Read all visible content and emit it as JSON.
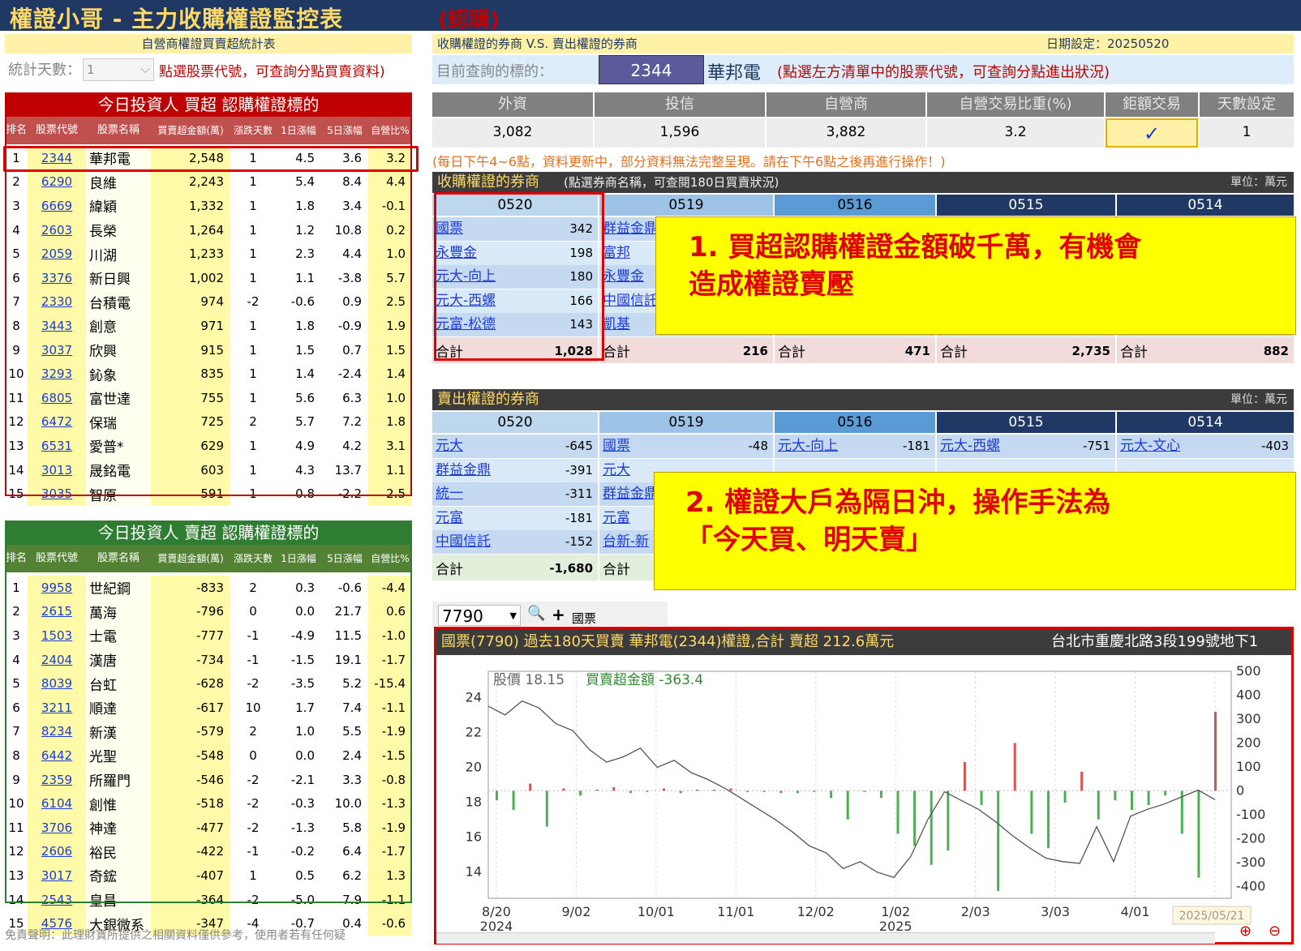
{
  "app": {
    "title": "權證小哥 - 主力收購權證監控表",
    "subtitle": "(認購)"
  },
  "left": {
    "top_bar": "自營商權證買賣超統計表",
    "days_label": "統計天數：",
    "days_value": "1",
    "hint": "點選股票代號，可查詢分點買賣資料)",
    "buy_title": "今日投資人 買超 認購權證標的",
    "sell_title": "今日投資人 賣超 認購權證標的",
    "headers": [
      "排名",
      "股票代號",
      "股票名稱",
      "買賣超金額(萬)",
      "漲跌天數",
      "1日漲幅",
      "5日漲幅",
      "自營比%"
    ],
    "buy_rows": [
      [
        "1",
        "2344",
        "華邦電",
        "2,548",
        "1",
        "4.5",
        "3.6",
        "3.2"
      ],
      [
        "2",
        "6290",
        "良維",
        "2,243",
        "1",
        "5.4",
        "8.4",
        "4.4"
      ],
      [
        "3",
        "6669",
        "緯穎",
        "1,332",
        "1",
        "1.8",
        "3.4",
        "-0.1"
      ],
      [
        "4",
        "2603",
        "長榮",
        "1,264",
        "1",
        "1.2",
        "10.8",
        "0.2"
      ],
      [
        "5",
        "2059",
        "川湖",
        "1,233",
        "1",
        "2.3",
        "4.4",
        "1.0"
      ],
      [
        "6",
        "3376",
        "新日興",
        "1,002",
        "1",
        "1.1",
        "-3.8",
        "5.7"
      ],
      [
        "7",
        "2330",
        "台積電",
        "974",
        "-2",
        "-0.6",
        "0.9",
        "2.5"
      ],
      [
        "8",
        "3443",
        "創意",
        "971",
        "1",
        "1.8",
        "-0.9",
        "1.9"
      ],
      [
        "9",
        "3037",
        "欣興",
        "915",
        "1",
        "1.5",
        "0.7",
        "1.5"
      ],
      [
        "10",
        "3293",
        "鈊象",
        "835",
        "1",
        "1.4",
        "-2.4",
        "1.4"
      ],
      [
        "11",
        "6805",
        "富世達",
        "755",
        "1",
        "5.6",
        "6.3",
        "1.0"
      ],
      [
        "12",
        "6472",
        "保瑞",
        "725",
        "2",
        "5.7",
        "7.2",
        "1.8"
      ],
      [
        "13",
        "6531",
        "愛普*",
        "629",
        "1",
        "4.9",
        "4.2",
        "3.1"
      ],
      [
        "14",
        "3013",
        "晟銘電",
        "603",
        "1",
        "4.3",
        "13.7",
        "1.1"
      ],
      [
        "15",
        "3035",
        "智原",
        "591",
        "1",
        "0.8",
        "-2.2",
        "2.5"
      ]
    ],
    "sell_rows": [
      [
        "1",
        "9958",
        "世紀鋼",
        "-833",
        "2",
        "0.3",
        "-0.6",
        "-4.4"
      ],
      [
        "2",
        "2615",
        "萬海",
        "-796",
        "0",
        "0.0",
        "21.7",
        "0.6"
      ],
      [
        "3",
        "1503",
        "士電",
        "-777",
        "-1",
        "-4.9",
        "11.5",
        "-1.0"
      ],
      [
        "4",
        "2404",
        "漢唐",
        "-734",
        "-1",
        "-1.5",
        "19.1",
        "-1.7"
      ],
      [
        "5",
        "8039",
        "台虹",
        "-628",
        "-2",
        "-3.5",
        "5.2",
        "-15.4"
      ],
      [
        "6",
        "3211",
        "順達",
        "-617",
        "10",
        "1.7",
        "7.4",
        "-1.1"
      ],
      [
        "7",
        "8234",
        "新漢",
        "-579",
        "2",
        "1.0",
        "5.5",
        "-1.9"
      ],
      [
        "8",
        "6442",
        "光聖",
        "-548",
        "0",
        "0.0",
        "2.4",
        "-1.5"
      ],
      [
        "9",
        "2359",
        "所羅門",
        "-546",
        "-2",
        "-2.1",
        "3.3",
        "-0.8"
      ],
      [
        "10",
        "6104",
        "創惟",
        "-518",
        "-2",
        "-0.3",
        "10.0",
        "-1.3"
      ],
      [
        "11",
        "3706",
        "神達",
        "-477",
        "-2",
        "-1.3",
        "5.8",
        "-1.9"
      ],
      [
        "12",
        "2606",
        "裕民",
        "-422",
        "-1",
        "-0.2",
        "6.4",
        "-1.7"
      ],
      [
        "13",
        "3017",
        "奇鋐",
        "-407",
        "1",
        "0.5",
        "6.2",
        "1.3"
      ],
      [
        "14",
        "2543",
        "皇昌",
        "-364",
        "-2",
        "-5.0",
        "7.9",
        "-1.1"
      ],
      [
        "15",
        "4576",
        "大銀微系",
        "-347",
        "-4",
        "-0.7",
        "0.4",
        "-0.6"
      ]
    ],
    "disclaimer": "免責聲明：此理財寶所提供之相關資料僅供參考，使用者若有任何疑"
  },
  "right": {
    "bar_title": "收購權證的券商 V.S. 賣出權證的券商",
    "date_label": "日期設定：",
    "date_value": "20250520",
    "query_label": "目前查詢的標的：",
    "query_code": "2344",
    "query_name": "華邦電",
    "query_hint": "(點選左方清單中的股票代號，可查詢分點進出狀況)",
    "stats_headers": [
      "外資",
      "投信",
      "自營商",
      "自營交易比重(%)",
      "鉅額交易",
      "天數設定"
    ],
    "stats_values": [
      "3,082",
      "1,596",
      "3,882",
      "3.2",
      "✓",
      "1"
    ],
    "notice": "(每日下午4~6點，資料更新中，部分資料無法完整呈現。請在下午6點之後再進行操作！)",
    "buy_section": {
      "title": "收購權證的券商",
      "hint": "(點選券商名稱，可查閱180日買賣狀況)",
      "unit": "單位：萬元"
    },
    "sell_section": {
      "title": "賣出權證的券商",
      "unit": "單位：萬元"
    },
    "dates": [
      "0520",
      "0519",
      "0516",
      "0515",
      "0514"
    ],
    "buy_cols": [
      {
        "rows": [
          [
            "國票",
            "342"
          ],
          [
            "永豐金",
            "198"
          ],
          [
            "元大-向上",
            "180"
          ],
          [
            "元大-西螺",
            "166"
          ],
          [
            "元富-松德",
            "143"
          ]
        ],
        "total": "1,028"
      },
      {
        "rows": [
          [
            "群益金鼎",
            ""
          ],
          [
            "富邦",
            ""
          ],
          [
            "永豐金",
            ""
          ],
          [
            "中國信託",
            ""
          ],
          [
            "凱基",
            ""
          ]
        ],
        "total": "216"
      },
      {
        "rows": [],
        "total": "471"
      },
      {
        "rows": [],
        "total": "2,735"
      },
      {
        "rows": [],
        "total": "882"
      }
    ],
    "sell_cols": [
      {
        "rows": [
          [
            "元大",
            "-645"
          ],
          [
            "群益金鼎",
            "-391"
          ],
          [
            "統一",
            "-311"
          ],
          [
            "元富",
            "-181"
          ],
          [
            "中國信託",
            "-152"
          ]
        ],
        "total": "-1,680"
      },
      {
        "rows": [
          [
            "國票",
            "-48"
          ],
          [
            "元大",
            ""
          ],
          [
            "群益金鼎",
            ""
          ],
          [
            "元富",
            ""
          ],
          [
            "台新-新",
            ""
          ]
        ],
        "total": ""
      },
      {
        "rows": [
          [
            "元大-向上",
            "-181"
          ]
        ],
        "total": ""
      },
      {
        "rows": [
          [
            "元大-西螺",
            "-751"
          ]
        ],
        "total": ""
      },
      {
        "rows": [
          [
            "元大-文心",
            "-403"
          ]
        ],
        "total": ""
      }
    ],
    "total_label": "合計",
    "callout1": [
      "1. 買超認購權證金額破千萬，有機會",
      "造成權證賣壓"
    ],
    "callout2": [
      "2.  權證大戶為隔日沖，操作手法為",
      "「今天買、明天賣」"
    ],
    "broker_code": "7790",
    "broker_name": "國票"
  },
  "chart_data": {
    "type": "bar+line",
    "title": "國票(7790) 過去180天買賣 華邦電(2344)權證,合計  賣超 212.6萬元",
    "address": "台北市重慶北路3段199號地下1",
    "legend_price": "股價 18.15",
    "legend_flow": "買賣超金額 -363.4",
    "x_tick_labels": [
      "8/20",
      "9/02",
      "10/01",
      "11/01",
      "12/02",
      "1/02",
      "2/03",
      "3/03",
      "4/01",
      "5/02"
    ],
    "x_year_labels": [
      "2024",
      "2025"
    ],
    "y_left_ticks": [
      "24",
      "22",
      "20",
      "18",
      "16",
      "14"
    ],
    "y_right_ticks": [
      "500",
      "400",
      "300",
      "200",
      "100",
      "0",
      "-100",
      "-200",
      "-300",
      "-400"
    ],
    "ylim_left": [
      12.5,
      25.5
    ],
    "ylim_right": [
      -450,
      500
    ],
    "price": [
      23.5,
      23.0,
      23.8,
      23.4,
      22.5,
      22.1,
      21.0,
      20.3,
      20.6,
      21.1,
      20.0,
      20.4,
      19.7,
      19.3,
      18.8,
      18.2,
      17.6,
      17.0,
      16.3,
      15.5,
      15.1,
      14.2,
      14.6,
      14.0,
      13.7,
      14.9,
      17.0,
      18.6,
      18.1,
      17.6,
      16.9,
      16.1,
      15.4,
      14.8,
      14.6,
      14.5,
      16.6,
      14.6,
      17.2,
      17.6,
      17.9,
      18.3,
      18.7,
      18.15
    ],
    "flow": [
      -40,
      -80,
      30,
      -150,
      10,
      -20,
      5,
      15,
      -10,
      -5,
      10,
      -10,
      5,
      5,
      10,
      -5,
      -5,
      -10,
      -10,
      -5,
      -30,
      -120,
      -5,
      -30,
      -180,
      -230,
      -310,
      -250,
      120,
      -60,
      -420,
      200,
      -180,
      -240,
      -50,
      80,
      -120,
      -40,
      -80,
      -60,
      -20,
      -180,
      -363.4,
      330
    ],
    "selected_date": "2025/05/21"
  }
}
